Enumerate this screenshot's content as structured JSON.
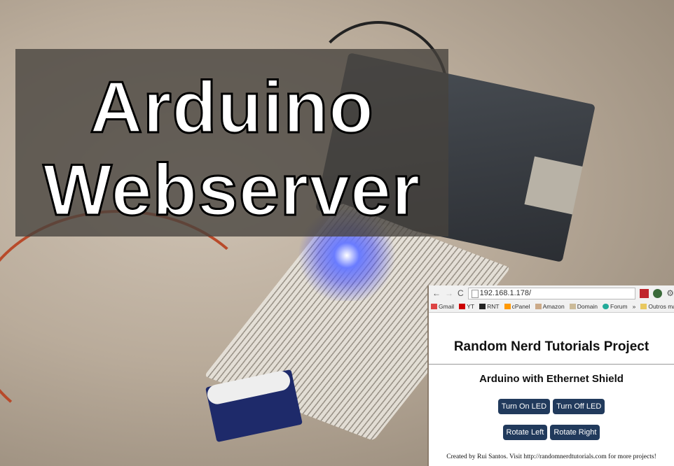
{
  "title": {
    "line1": "Arduino",
    "line2": "Webserver"
  },
  "browser": {
    "url": "192.168.1.178/",
    "bookmarks": [
      "Gmail",
      "YT",
      "RNT",
      "cPanel",
      "Amazon",
      "Domain",
      "Forum",
      "»",
      "Outros marca"
    ],
    "page": {
      "heading": "Random Nerd Tutorials Project",
      "subheading": "Arduino with Ethernet Shield",
      "buttons": [
        "Turn On LED",
        "Turn Off LED",
        "Rotate Left",
        "Rotate Right"
      ],
      "footer": "Created by Rui Santos. Visit http://randomnerdtutorials.com for more projects!"
    }
  },
  "colors": {
    "button": "#213a5c",
    "overlay": "#46423e"
  }
}
